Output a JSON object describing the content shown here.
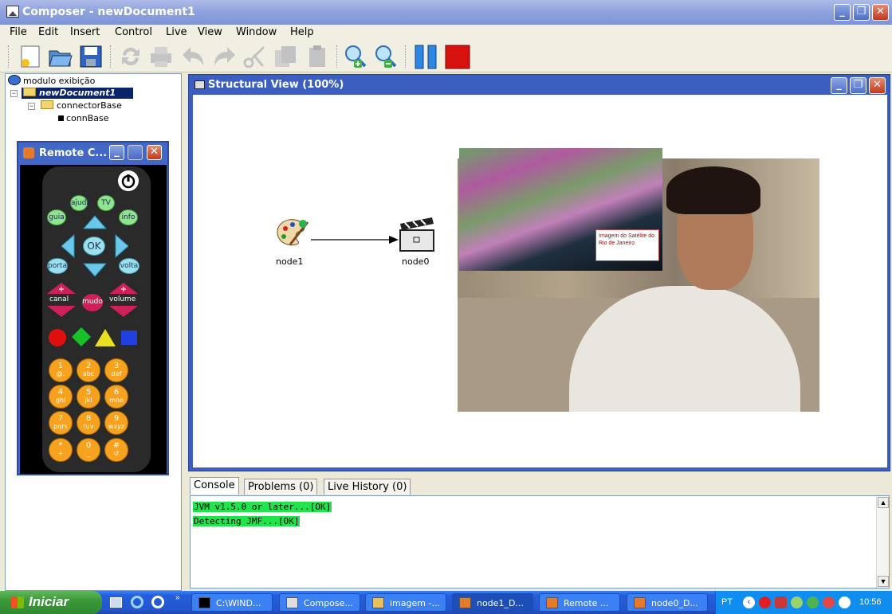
{
  "window": {
    "title": "Composer - newDocument1"
  },
  "menu": [
    "File",
    "Edit",
    "Insert",
    "Control",
    "Live",
    "View",
    "Window",
    "Help"
  ],
  "toolbar": {
    "icons": [
      "new-document-icon",
      "open-folder-icon",
      "save-icon",
      "refresh-icon",
      "print-icon",
      "undo-icon",
      "redo-icon",
      "cut-icon",
      "copy-icon",
      "paste-icon",
      "zoom-in-icon",
      "zoom-out-icon",
      "pause-icon",
      "stop-icon"
    ]
  },
  "tree": {
    "root": "modulo exibição",
    "document": "newDocument1",
    "base": "connectorBase",
    "leaf": "connBase"
  },
  "remote": {
    "title": "Remote C...",
    "ok": "OK",
    "ajuda": "ajuda",
    "tv": "TV",
    "guia": "guia",
    "info": "info",
    "portal": "portal",
    "volta": "volta",
    "canal": "canal",
    "mudo": "mudo",
    "volume": "volume",
    "keys": [
      {
        "n": "1",
        "s": "@."
      },
      {
        "n": "2",
        "s": "abc"
      },
      {
        "n": "3",
        "s": "def"
      },
      {
        "n": "4",
        "s": "ghi"
      },
      {
        "n": "5",
        "s": "jkl"
      },
      {
        "n": "6",
        "s": "mno"
      },
      {
        "n": "7",
        "s": "pqrs"
      },
      {
        "n": "8",
        "s": "tuv"
      },
      {
        "n": "9",
        "s": "wxyz"
      },
      {
        "n": "*",
        "s": "+"
      },
      {
        "n": "0",
        "s": "_"
      },
      {
        "n": "#",
        "s": "↺"
      }
    ]
  },
  "structural_view": {
    "title": "Structural View (100%)",
    "node1": "node1",
    "node0": "node0",
    "overlay_text": "Imagem do Satélite do Rio de Janeiro"
  },
  "bottom_tabs": [
    "Console",
    "Problems (0)",
    "Live History (0)"
  ],
  "console": [
    "JVM v1.5.0 or later...[OK]",
    "Detecting JMF...[OK]"
  ],
  "taskbar": {
    "start": "Iniciar",
    "tasks": [
      "C:\\WIND...",
      "Compose...",
      "imagem -...",
      "node1_D...",
      "Remote ...",
      "node0_D..."
    ],
    "lang": "PT",
    "clock": "10:56"
  }
}
